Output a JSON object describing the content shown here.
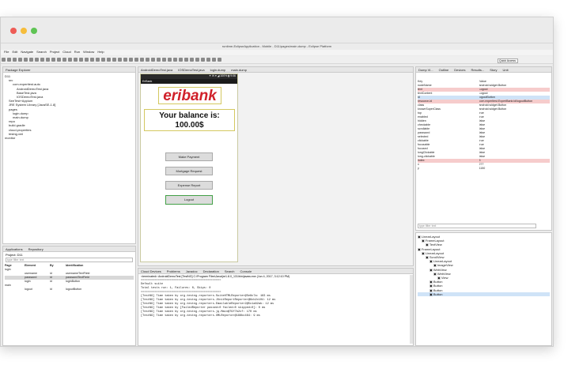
{
  "window": {
    "title": "runtime-EclipseApplication - Mobile - D11/pages/main.dump - Eclipse Platform"
  },
  "menu": [
    "File",
    "Edit",
    "Navigate",
    "Search",
    "Project",
    "Cloud",
    "Run",
    "Window",
    "Help"
  ],
  "quick_access": "Quick Access",
  "package_explorer": {
    "title": "Package Explorer",
    "items": [
      {
        "indent": 0,
        "label": "D11"
      },
      {
        "indent": 1,
        "label": "src"
      },
      {
        "indent": 2,
        "label": "com.experitest.auto"
      },
      {
        "indent": 3,
        "label": "AndroidDemoTest.java"
      },
      {
        "indent": 3,
        "label": "BaseTest.java"
      },
      {
        "indent": 3,
        "label": "IOSDemoTest.java"
      },
      {
        "indent": 1,
        "label": "SeeTest+Appium"
      },
      {
        "indent": 1,
        "label": "JRE System Library [JavaSE-1.8]"
      },
      {
        "indent": 1,
        "label": "pages"
      },
      {
        "indent": 2,
        "label": "login.dump"
      },
      {
        "indent": 2,
        "label": "main.dump"
      },
      {
        "indent": 1,
        "label": "repo"
      },
      {
        "indent": 1,
        "label": "build.gradle"
      },
      {
        "indent": 1,
        "label": "cloud.properties"
      },
      {
        "indent": 1,
        "label": "testng.xml"
      },
      {
        "indent": 0,
        "label": "monitor"
      }
    ]
  },
  "repository": {
    "tabs": [
      "Applications",
      "Repository"
    ],
    "project": "Project: D11",
    "filter": "type filter text",
    "columns": [
      "Page",
      "Element",
      "By",
      "Identification"
    ],
    "rows": [
      {
        "page": "login",
        "element": "",
        "by": "",
        "id": ""
      },
      {
        "page": "",
        "element": "username",
        "by": "id",
        "id": "usernameTextField"
      },
      {
        "page": "",
        "element": "password",
        "by": "id",
        "id": "passwordTextField"
      },
      {
        "page": "",
        "element": "login",
        "by": "id",
        "id": "loginButton"
      },
      {
        "page": "main",
        "element": "",
        "by": "",
        "id": ""
      },
      {
        "page": "",
        "element": "logout",
        "by": "id",
        "id": "logoutButton"
      }
    ]
  },
  "editor": {
    "tabs": [
      "AndroidDemoTest.java",
      "IOSDemoTest.java",
      "login.dump",
      "main.dump"
    ],
    "status_bar": "✦ ✉  ▾ ◢ 100% ▮ 9:06",
    "app_bar": "EriBank",
    "logo": "eribank",
    "balance_label": "Your balance is:",
    "balance_value": "100.00$",
    "buttons": [
      "Make Payment",
      "Mortgage Request",
      "Expense Report",
      "Logout"
    ]
  },
  "console": {
    "tabs": [
      "Cloud Devices",
      "Problems",
      "Javadoc",
      "Declaration",
      "Search",
      "Console"
    ],
    "path": "<terminated> AndroidDemoTest [TestNG] C:\\Program Files\\Java\\jre1.8.0_131\\bin\\javaw.exe (Jun 4, 2017, 3:12:10 PM)",
    "lines": [
      "",
      "",
      "",
      "===============================================",
      "Default suite",
      "Total tests run: 1, Failures: 0, Skips: 0",
      "===============================================",
      "",
      "[TestNG] Time taken by org.testng.reporters.SuiteHTMLReporter@5e8c7a: 183 ms",
      "[TestNG] Time taken by org.testng.reporters.JUnitReportReporter@6cb2c104: 12 ms",
      "[TestNG] Time taken by org.testng.reporters.EmailableReporter2@5c1a82ab: 12 ms",
      "[TestNG] Time taken by [FailedReporter passed=0 failed=0 skipped=0]: 0 ms",
      "[TestNG] Time taken by org.testng.reporters.jq.Main@79f7b2cf: 170 ms",
      "[TestNG] Time taken by org.testng.reporters.XMLReporter@188bc464: 9 ms"
    ]
  },
  "properties": {
    "tabs": [
      "Dump Vi...",
      "Outline",
      "Devices",
      "Results...",
      "Story",
      "Unit"
    ],
    "columns": [
      "Key",
      "Value"
    ],
    "rows": [
      {
        "key": "nodeName",
        "value": "android.widget.Button",
        "hl": ""
      },
      {
        "key": "text",
        "value": "Logout",
        "hl": "red"
      },
      {
        "key": "textContent",
        "value": "Logout",
        "hl": ""
      },
      {
        "key": "id",
        "value": "logoutButton",
        "hl": "sel"
      },
      {
        "key": "resource-id",
        "value": "com.experitest.ExperiBank:id/logoutButton",
        "hl": "red"
      },
      {
        "key": "class",
        "value": "android.widget.Button",
        "hl": ""
      },
      {
        "key": "knownSuperClass",
        "value": "android.widget.Button",
        "hl": ""
      },
      {
        "key": "top",
        "value": "true",
        "hl": ""
      },
      {
        "key": "enabled",
        "value": "true",
        "hl": ""
      },
      {
        "key": "hidden",
        "value": "false",
        "hl": ""
      },
      {
        "key": "checkable",
        "value": "false",
        "hl": ""
      },
      {
        "key": "scrollable",
        "value": "false",
        "hl": ""
      },
      {
        "key": "password",
        "value": "false",
        "hl": ""
      },
      {
        "key": "selected",
        "value": "false",
        "hl": ""
      },
      {
        "key": "clickable",
        "value": "true",
        "hl": ""
      },
      {
        "key": "focusable",
        "value": "true",
        "hl": ""
      },
      {
        "key": "focused",
        "value": "false",
        "hl": ""
      },
      {
        "key": "longClickable",
        "value": "false",
        "hl": ""
      },
      {
        "key": "long-clickable",
        "value": "false",
        "hl": ""
      },
      {
        "key": "index",
        "value": "5",
        "hl": "red"
      },
      {
        "key": "x",
        "value": "277",
        "hl": ""
      },
      {
        "key": "y",
        "value": "1150",
        "hl": ""
      }
    ],
    "filter": "type filter text"
  },
  "hierarchy": {
    "items": [
      {
        "indent": 0,
        "label": "LinearLayout"
      },
      {
        "indent": 1,
        "label": "FrameLayout"
      },
      {
        "indent": 2,
        "label": "TextView"
      },
      {
        "indent": 0,
        "label": "FrameLayout"
      },
      {
        "indent": 1,
        "label": "LinearLayout"
      },
      {
        "indent": 2,
        "label": "ScrollView"
      },
      {
        "indent": 3,
        "label": "LinearLayout"
      },
      {
        "indent": 4,
        "label": "ImageView"
      },
      {
        "indent": 3,
        "label": "WebView"
      },
      {
        "indent": 4,
        "label": "WebView"
      },
      {
        "indent": 5,
        "label": "View"
      },
      {
        "indent": 3,
        "label": "Button"
      },
      {
        "indent": 3,
        "label": "Button"
      },
      {
        "indent": 3,
        "label": "Button"
      },
      {
        "indent": 3,
        "label": "Button"
      }
    ]
  },
  "colors": {
    "traffic_red": "#ee5c56",
    "traffic_yellow": "#f6bd3b",
    "traffic_green": "#5fc454",
    "logo_red": "#d0202a",
    "highlight": "#f6cccc"
  }
}
